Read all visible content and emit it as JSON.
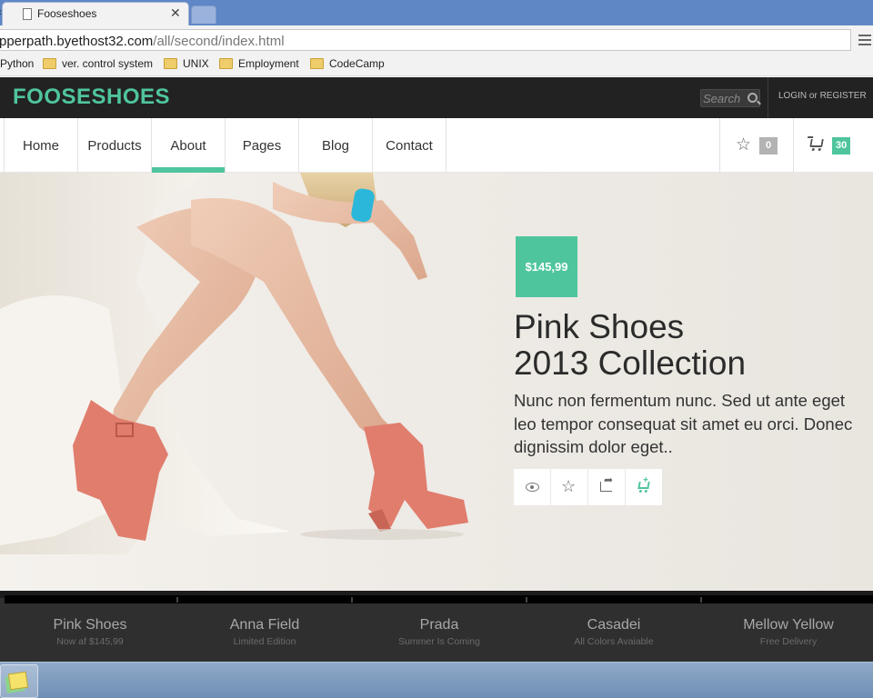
{
  "browser": {
    "tab_title": "Fooseshoes",
    "url_host": "pperpath.byethost32.com",
    "url_path": "/all/second/index.html",
    "bookmarks": [
      "Python",
      "ver. control system",
      "UNIX",
      "Employment",
      "CodeCamp"
    ]
  },
  "header": {
    "logo": "FOOSESHOES",
    "search_placeholder": "Search",
    "login": "LOGIN or REGISTER"
  },
  "nav": {
    "items": [
      "Home",
      "Products",
      "About",
      "Pages",
      "Blog",
      "Contact"
    ],
    "active": "About",
    "wishlist_count": "0",
    "cart_count": "30"
  },
  "hero": {
    "price": "$145,99",
    "title_line1": "Pink Shoes",
    "title_line2": "2013 Collection",
    "text": "Nunc non fermentum nunc. Sed ut ante eget leo tempor consequat sit amet eu orci. Donec dignissim dolor eget.."
  },
  "slides": [
    {
      "title": "Pink Shoes",
      "sub": "Now af $145,99"
    },
    {
      "title": "Anna Field",
      "sub": "Limited Edition"
    },
    {
      "title": "Prada",
      "sub": "Summer Is Coming"
    },
    {
      "title": "Casadei",
      "sub": "All Colors Avaiable"
    },
    {
      "title": "Mellow Yellow",
      "sub": "Free Delivery"
    }
  ],
  "colors": {
    "accent": "#4fc59e",
    "header_bg": "#222222",
    "badge_gray": "#b3b3b3"
  }
}
